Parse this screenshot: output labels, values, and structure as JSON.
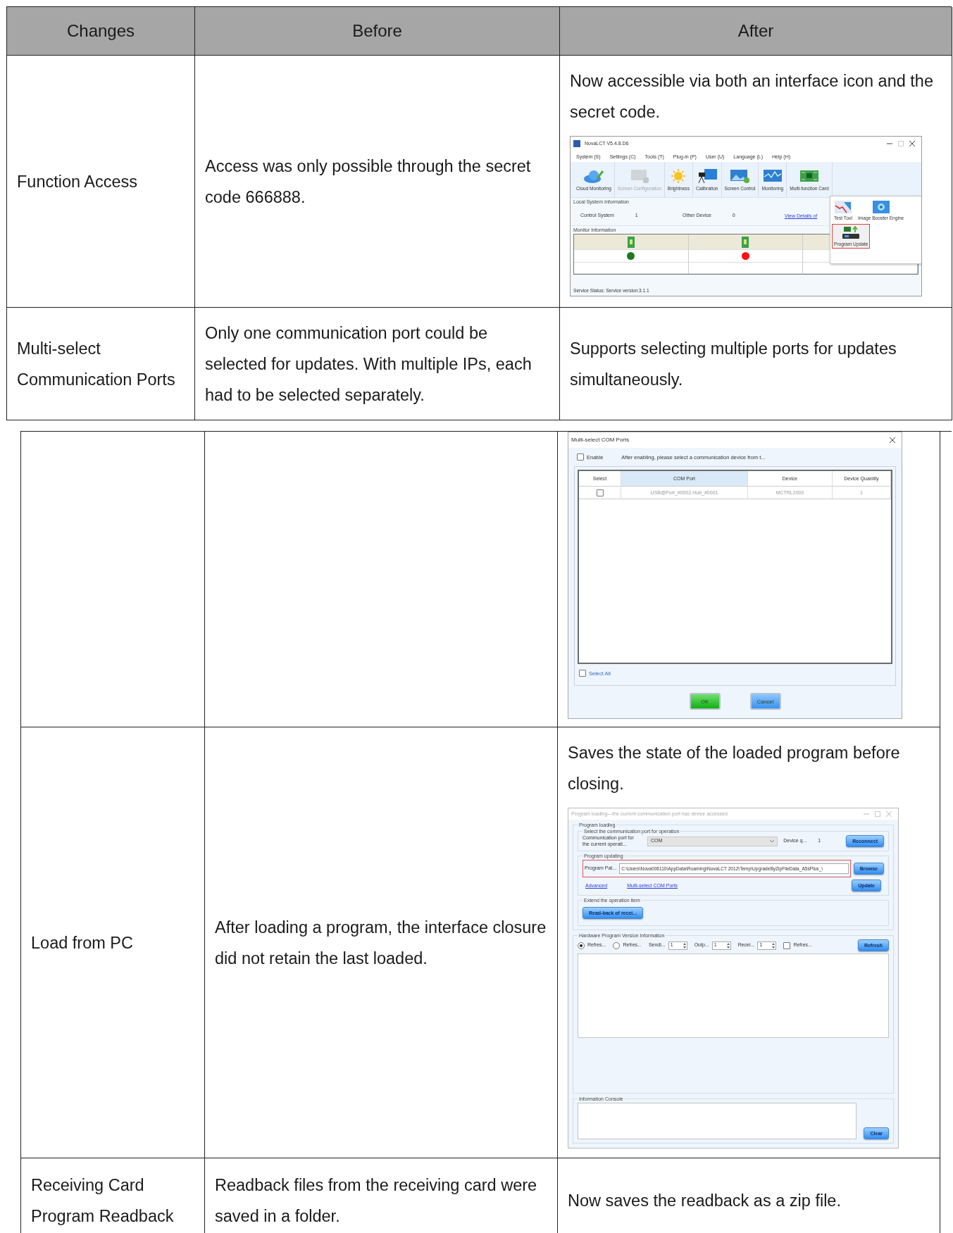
{
  "tables": [
    {
      "header": [
        "Changes",
        "Before",
        "After"
      ],
      "rows": [
        {
          "change": "Function Access",
          "before": "Access was only possible through the secret code 666888.",
          "after": "Now accessible via both an interface icon and the secret code.",
          "screenshot": {
            "kind": "main_window",
            "title": "NovaLCT V5.4.8.D6",
            "menu": [
              "System (S)",
              "Settings (C)",
              "Tools (T)",
              "Plug-in (P)",
              "User (U)",
              "Language (L)",
              "Help (H)"
            ],
            "tools": [
              {
                "label": "Cloud Monitoring",
                "disabled": false
              },
              {
                "label": "Screen Configuration",
                "disabled": true
              },
              {
                "label": "Brightness",
                "disabled": false
              },
              {
                "label": "Calibration",
                "disabled": false
              },
              {
                "label": "Screen Control",
                "disabled": false
              },
              {
                "label": "Monitoring",
                "disabled": false
              },
              {
                "label": "Multi-function Card",
                "disabled": false
              }
            ],
            "local_section": "Local System Information",
            "local_items": [
              {
                "label": "Control System",
                "value": "1"
              },
              {
                "label": "Other Device",
                "value": "0"
              }
            ],
            "link": "View Details of",
            "monitor_section": "Monitor Information",
            "statuses": [
              {
                "color": "#1e7a1e"
              },
              {
                "color": "#ff1010"
              }
            ],
            "status_bar": "Service Status:  Service version:3.1.1",
            "dropdown": [
              {
                "label": "Test Tool",
                "highlighted": false
              },
              {
                "label": "Image Booster Engine",
                "highlighted": false
              },
              {
                "label": "Program Update",
                "highlighted": true
              }
            ]
          }
        },
        {
          "change": "Multi-select Communication Ports",
          "before": "Only one communication port could be selected for updates. With multiple IPs, each had to be selected separately.",
          "after": "Supports selecting multiple ports for updates simultaneously."
        }
      ]
    },
    {
      "rows": [
        {
          "screenshot": {
            "kind": "com_dialog",
            "title": "Multi-select COM Ports",
            "enable": {
              "label": "Enable",
              "checked": false
            },
            "hint": "After enabling, please select a communication device from t...",
            "columns": [
              {
                "label": "Select",
                "selected": false
              },
              {
                "label": "COM Port",
                "selected": true
              },
              {
                "label": "Device",
                "selected": false
              },
              {
                "label": "Device Quantity",
                "selected": false
              }
            ],
            "rows": [
              {
                "checked": false,
                "port": "USB@Port_#0002.Hub_#0001",
                "device": "MCTRL2000",
                "quantity": "1"
              }
            ],
            "select_all": {
              "label": "Select All",
              "checked": false
            },
            "buttons": [
              "OK",
              "Cancel"
            ]
          }
        },
        {
          "change": "Load from PC",
          "before": "After loading a program, the interface closure did not retain the last loaded.",
          "after": "Saves the state of the loaded program before closing.",
          "screenshot": {
            "kind": "loading_dialog",
            "title": "Program loading—the current communication port has device accessed",
            "loading_group": "Program loading",
            "port_group": "Select the communication port for operation",
            "port_label": "Communication port for the current operati...",
            "port_value": "COM",
            "device_label": "Device q...",
            "device_value": "1",
            "reconnect": "Reconnect",
            "updating_group": "Program updating",
            "path_label": "Program Pat...",
            "path_value": "C:\\Users\\Nova006110\\AppData\\Roaming\\NovaLCT 2012\\Temp\\UpgradeByZipFileData_A5sPlus_\\",
            "path_highlighted": true,
            "browse": "Browse",
            "links": [
              "Advanced",
              "Multi-select COM Ports"
            ],
            "update": "Update",
            "extend_group": "Extend the operation item",
            "readback": "Read-back of recei...",
            "hardware_group": "Hardware Program Version Information",
            "options": [
              {
                "kind": "radio",
                "label": "Refres...",
                "checked": true
              },
              {
                "kind": "radio",
                "label": "Refres...",
                "checked": false
              },
              {
                "kind": "spin",
                "label": "Sendi...",
                "value": "1"
              },
              {
                "kind": "spin",
                "label": "Outp...",
                "value": "1"
              },
              {
                "kind": "spin",
                "label": "Recei...",
                "value": "1"
              },
              {
                "kind": "checkbox",
                "label": "Refres...",
                "checked": false
              }
            ],
            "refresh": "Refresh",
            "console_group": "Information Console",
            "clear": "Clear"
          }
        },
        {
          "change": "Receiving Card Program Readback",
          "before": "Readback files from the receiving card were saved in a folder.",
          "after": "Now saves the readback as a zip file."
        }
      ]
    }
  ]
}
